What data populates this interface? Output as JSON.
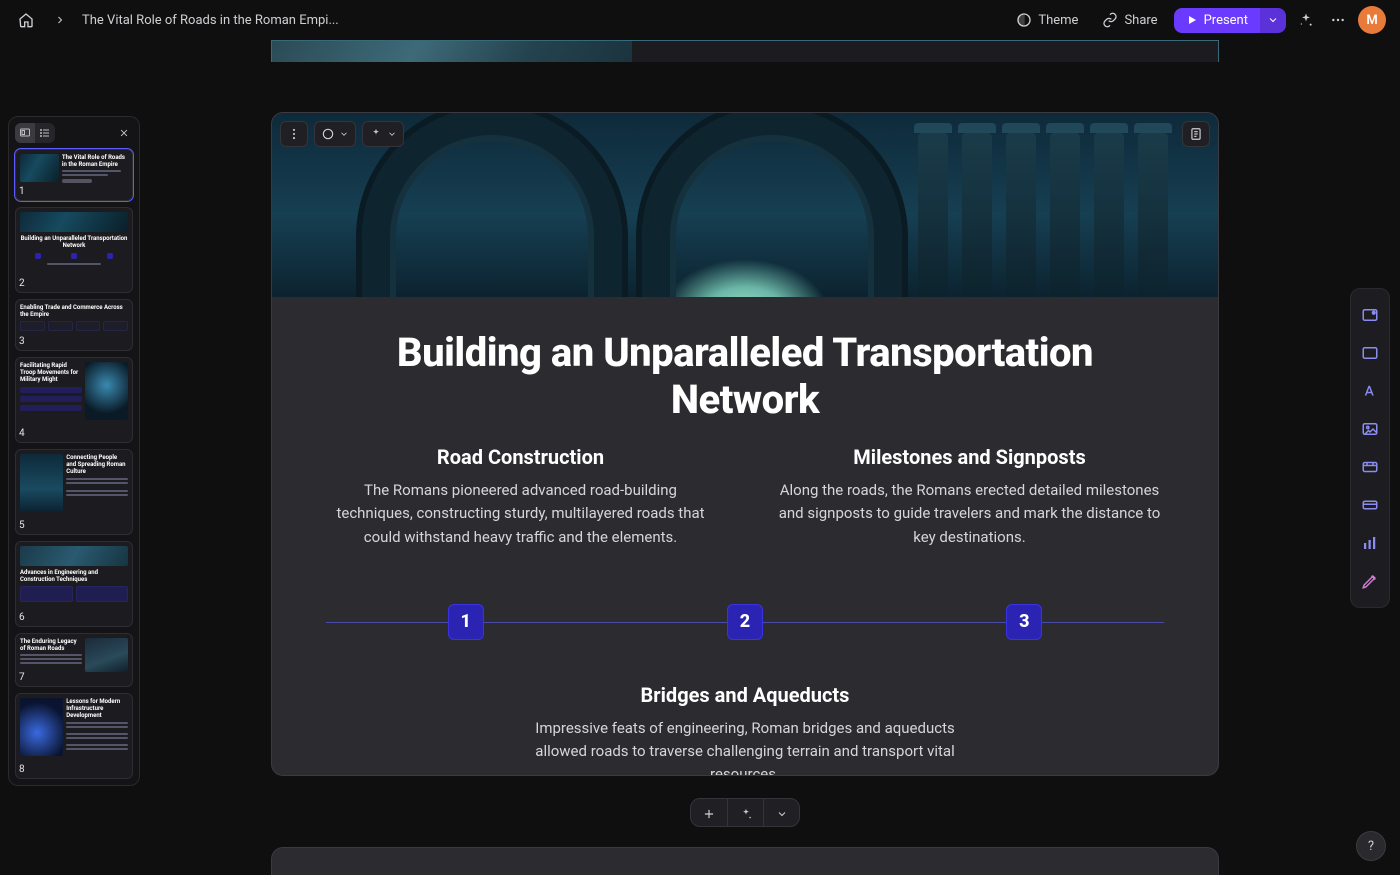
{
  "header": {
    "doc_title": "The Vital Role of Roads in the Roman Empi...",
    "theme_label": "Theme",
    "share_label": "Share",
    "present_label": "Present",
    "avatar_initial": "M"
  },
  "sidebar": {
    "thumbs": [
      {
        "num": "1",
        "title": "The Vital Role of Roads in the Roman Empire"
      },
      {
        "num": "2",
        "title": "Building an Unparalleled Transportation Network"
      },
      {
        "num": "3",
        "title": "Enabling Trade and Commerce Across the Empire"
      },
      {
        "num": "4",
        "title": "Facilitating Rapid Troop Movements for Military Might"
      },
      {
        "num": "5",
        "title": "Connecting People and Spreading Roman Culture"
      },
      {
        "num": "6",
        "title": "Advances in Engineering and Construction Techniques"
      },
      {
        "num": "7",
        "title": "The Enduring Legacy of Roman Roads"
      },
      {
        "num": "8",
        "title": "Lessons for Modern Infrastructure Development"
      }
    ]
  },
  "slide": {
    "title": "Building an Unparalleled Transportation Network",
    "block1": {
      "heading": "Road Construction",
      "body": "The Romans pioneered advanced road-building techniques, constructing sturdy, multilayered roads that could withstand heavy traffic and the elements."
    },
    "block2": {
      "heading": "Milestones and Signposts",
      "body": "Along the roads, the Romans erected detailed milestones and signposts to guide travelers and mark the distance to key destinations."
    },
    "block3": {
      "heading": "Bridges and Aqueducts",
      "body": "Impressive feats of engineering, Roman bridges and aqueducts allowed roads to traverse challenging terrain and transport vital resources."
    },
    "nodes": [
      "1",
      "2",
      "3"
    ]
  },
  "help_glyph": "?"
}
